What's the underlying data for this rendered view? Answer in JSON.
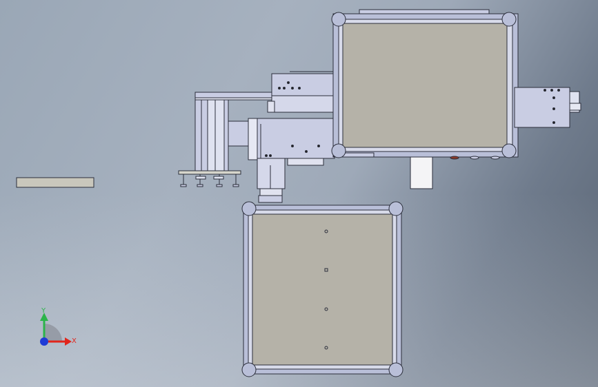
{
  "viewport": {
    "background_top": "#9aa7b6",
    "background_right": "#55606f",
    "frame_color": "#b9bfd8",
    "frame_stroke": "#2a2d3a",
    "panel_fill": "#b5b2a8",
    "body_fill": "#c9cde3"
  },
  "triad": {
    "x_label": "X",
    "y_label": "Y",
    "x_color": "#e1261c",
    "y_color": "#2bb44a",
    "z_color": "#1f3bd6"
  }
}
